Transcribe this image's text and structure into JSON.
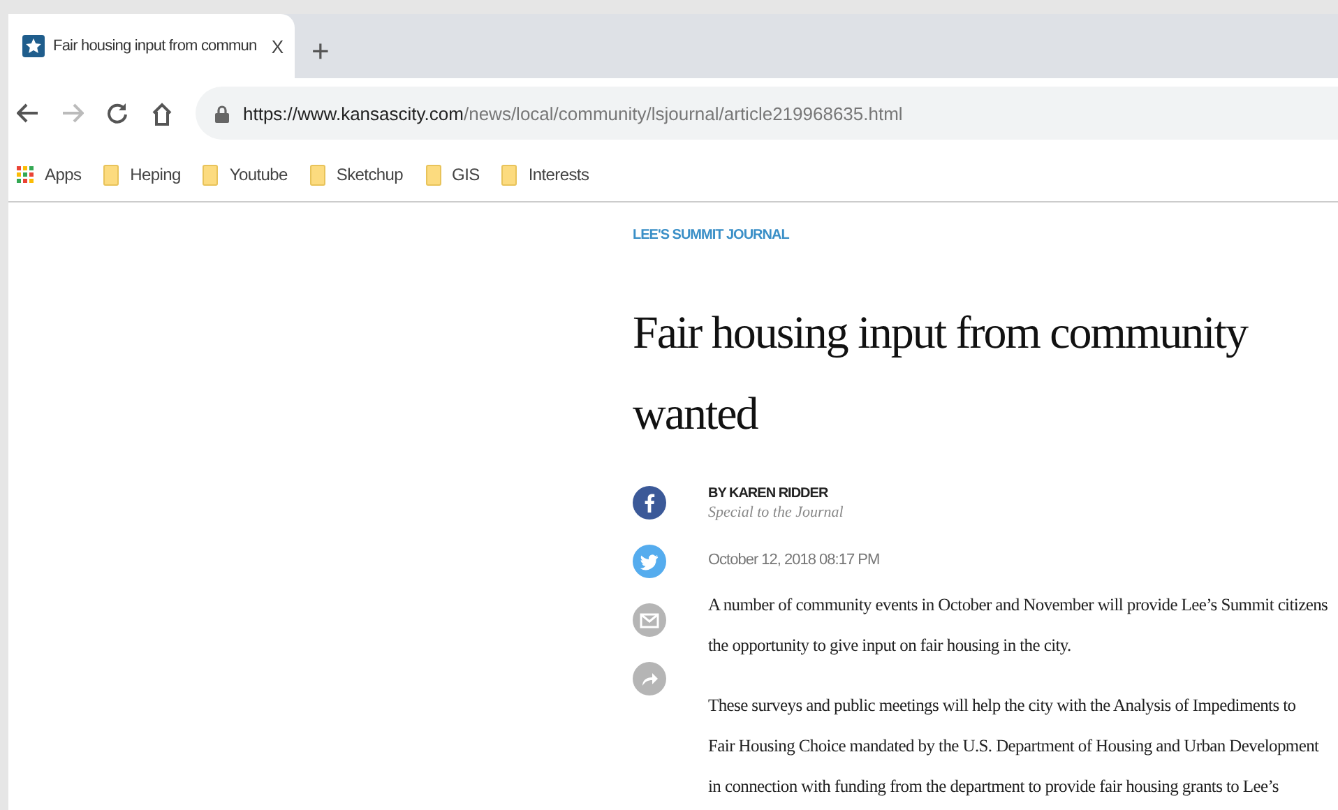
{
  "tab": {
    "title": "Fair housing input from commun",
    "close": "X",
    "new_tab": "+"
  },
  "address_bar": {
    "host": "https://www.kansascity.com",
    "path": "/news/local/community/lsjournal/article219968635.html"
  },
  "bookmarks": [
    {
      "label": "Apps",
      "kind": "apps"
    },
    {
      "label": "Heping",
      "kind": "folder"
    },
    {
      "label": "Youtube",
      "kind": "folder"
    },
    {
      "label": "Sketchup",
      "kind": "folder"
    },
    {
      "label": "GIS",
      "kind": "folder"
    },
    {
      "label": "Interests",
      "kind": "folder"
    }
  ],
  "article": {
    "section": "LEE'S SUMMIT JOURNAL",
    "headline_lines": [
      "Fair housing input from community",
      "wanted"
    ],
    "byline": "BY KAREN RIDDER",
    "byline_note": "Special to the Journal",
    "date": "October 12, 2018 08:17 PM",
    "share": [
      {
        "kind": "facebook"
      },
      {
        "kind": "twitter"
      },
      {
        "kind": "email"
      },
      {
        "kind": "share"
      }
    ],
    "paragraphs": [
      [
        "A number of community events in October and November will provide Lee’s Summit citizens",
        "the opportunity to give input on fair housing in the city."
      ],
      [
        "These surveys and public meetings will help the city with the Analysis of Impediments to",
        "Fair Housing Choice mandated by the U.S. Department of Housing and Urban Development",
        "in connection with funding from the department to provide fair housing grants to Lee’s"
      ]
    ]
  }
}
